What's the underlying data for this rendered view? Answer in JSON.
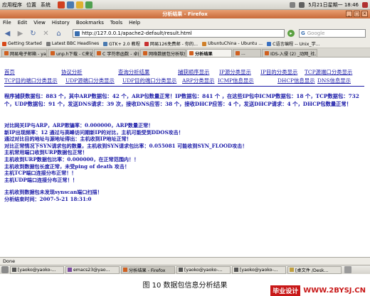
{
  "top_panel": {
    "menus": [
      "应用程序",
      "位置",
      "系统"
    ],
    "datetime": "5月21日星期一 18:46"
  },
  "window": {
    "title": "分析结果 - Firefox"
  },
  "menubar": [
    "File",
    "Edit",
    "View",
    "History",
    "Bookmarks",
    "Tools",
    "Help"
  ],
  "navigation": {
    "url": "http://127.0.0.1/apache2-default/result.html",
    "search_placeholder": "Google"
  },
  "bookmarks": [
    {
      "label": "Getting Started",
      "color": "#d84818"
    },
    {
      "label": "Latest BBC Headlines",
      "color": "#7a7a7a"
    },
    {
      "label": "GTK+ 2.0 教程",
      "color": "#4a7ab0"
    },
    {
      "label": "网易126免费邮 - 你的...",
      "color": "#c83030"
    },
    {
      "label": "UbuntuChina - Ubuntu ...",
      "color": "#d0802a"
    },
    {
      "label": "C语言编程 -- Unix_学...",
      "color": "#3a70c0"
    }
  ],
  "tabs": [
    {
      "label": "网易电子邮箱 - yaoko@...",
      "active": false
    },
    {
      "label": "unp.h下载 - C来记 - 2A...",
      "active": false
    },
    {
      "label": "C 字符串函数 - 卓的...",
      "active": false
    },
    {
      "label": "网络数据包分析软件",
      "active": false
    },
    {
      "label": "分析结果",
      "active": true
    },
    {
      "label": "...",
      "active": false
    },
    {
      "label": "IDS-入侵 (2) _动网_社...",
      "active": false
    }
  ],
  "page": {
    "nav_row1": [
      "首页",
      "协议分析",
      "查询分析结果",
      "捕获顺序显示",
      "IP源分类显示",
      "IP目的分类显示",
      "TCP源端口分类显示"
    ],
    "nav_row2": [
      "TCP目的端口分类显示",
      "UDP源端口分类显示",
      "UDP目的端口分类显示",
      "ARP分类显示",
      "ICMP信息显示",
      "DHCP信息显示",
      "DNS信息显示"
    ],
    "summary": "程序捕获数据包：883 个，其中ARP数据包：42 个，ARP包数量正常！IP数据包：841 个 ，在这些IP包中ICMP数据包：18 个，TCP数据包：732 个，UDP数据包：91 个，发送DNS请求：39 次，接收DNS应答：38 个，接收DHCP应答：4 个，发送DHCP请求：4 个，DHCP包数量正常！",
    "analysis": [
      {
        "text": "对比网关IP与ARP，ARP欺骗率：0.000000，ARP数量正常！",
        "red": false
      },
      {
        "text": "新IP出现频率：12 通过与高峰访问期新IP的对比，主机可能受到DDOS攻击！",
        "red": false
      },
      {
        "text": "通过对比目的地址与源地址得出：主机收到IP地址正常！",
        "red": false
      },
      {
        "text": "对比正常情况下SYN请求包的数量，主机收到SYN请求包比率：0.055081 可能收到SYN_FLOOD攻击！",
        "red": false
      },
      {
        "text": "主机常用端口收到URP数据包正常！",
        "red": false
      },
      {
        "text": "主机收到URP数据包比率：0.000000，在正常范围内！！",
        "red": false
      },
      {
        "text": "主机收到数据包长度正常，未受ping of death 攻击！",
        "red": false
      },
      {
        "text": "主机TCP端口连接分布正常！！",
        "red": false
      },
      {
        "text": "主机UDP端口连接分布正常！！",
        "red": false
      },
      {
        "text": "",
        "red": false
      },
      {
        "text": "主机收到数据包未发现synscan端口扫描！",
        "red": false
      },
      {
        "text": "分析结束时间：2007-5-21 18:31:0",
        "red": false
      }
    ]
  },
  "status": {
    "text": "Done"
  },
  "taskbar": [
    {
      "label": "[yaoko@yaoko-...",
      "active": false
    },
    {
      "label": "emacs23@yao...",
      "active": false
    },
    {
      "label": "分析结果 - Firefox",
      "active": true
    },
    {
      "label": "[yaoko@yaoko-...",
      "active": false
    },
    {
      "label": "[yaoko@yaoko-...",
      "active": false
    },
    {
      "label": "[桌文件 /Desk...",
      "active": false
    }
  ],
  "caption": "图 10  数据包信息分析结果",
  "watermark": {
    "brand": "毕业设计",
    "site": "WWW.2BYSJ.CN"
  }
}
